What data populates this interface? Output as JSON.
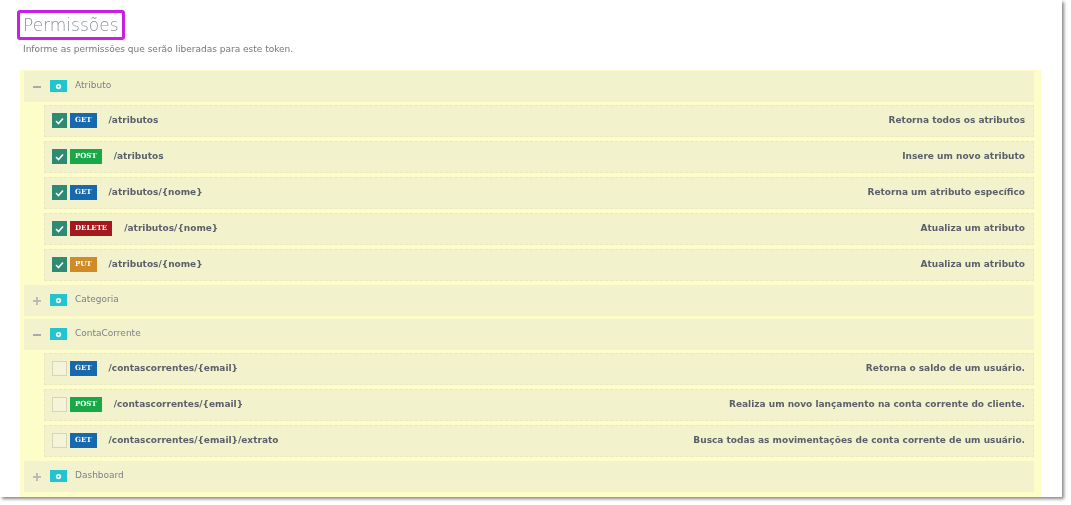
{
  "header": {
    "title": "Permissões",
    "highlighted": true,
    "subtitle": "Informe as permissões que serão liberadas para este token."
  },
  "groups": [
    {
      "name": "Atributo",
      "expanded": true,
      "endpoints": [
        {
          "method": "GET",
          "path": "/atributos",
          "description": "Retorna todos os atributos",
          "checked": true
        },
        {
          "method": "POST",
          "path": "/atributos",
          "description": "Insere um novo atributo",
          "checked": true
        },
        {
          "method": "GET",
          "path": "/atributos/{nome}",
          "description": "Retorna um atributo específico",
          "checked": true
        },
        {
          "method": "DELETE",
          "path": "/atributos/{nome}",
          "description": "Atualiza um atributo",
          "checked": true
        },
        {
          "method": "PUT",
          "path": "/atributos/{nome}",
          "description": "Atualiza um atributo",
          "checked": true
        }
      ]
    },
    {
      "name": "Categoria",
      "expanded": false
    },
    {
      "name": "ContaCorrente",
      "expanded": true,
      "endpoints": [
        {
          "method": "GET",
          "path": "/contascorrentes/{email}",
          "description": "Retorna o saldo de um usuário.",
          "checked": false
        },
        {
          "method": "POST",
          "path": "/contascorrentes/{email}",
          "description": "Realiza um novo lançamento na conta corrente do cliente.",
          "checked": false
        },
        {
          "method": "GET",
          "path": "/contascorrentes/{email}/extrato",
          "description": "Busca todas as movimentações de conta corrente de um usuário.",
          "checked": false
        }
      ]
    },
    {
      "name": "Dashboard",
      "expanded": false
    }
  ]
}
